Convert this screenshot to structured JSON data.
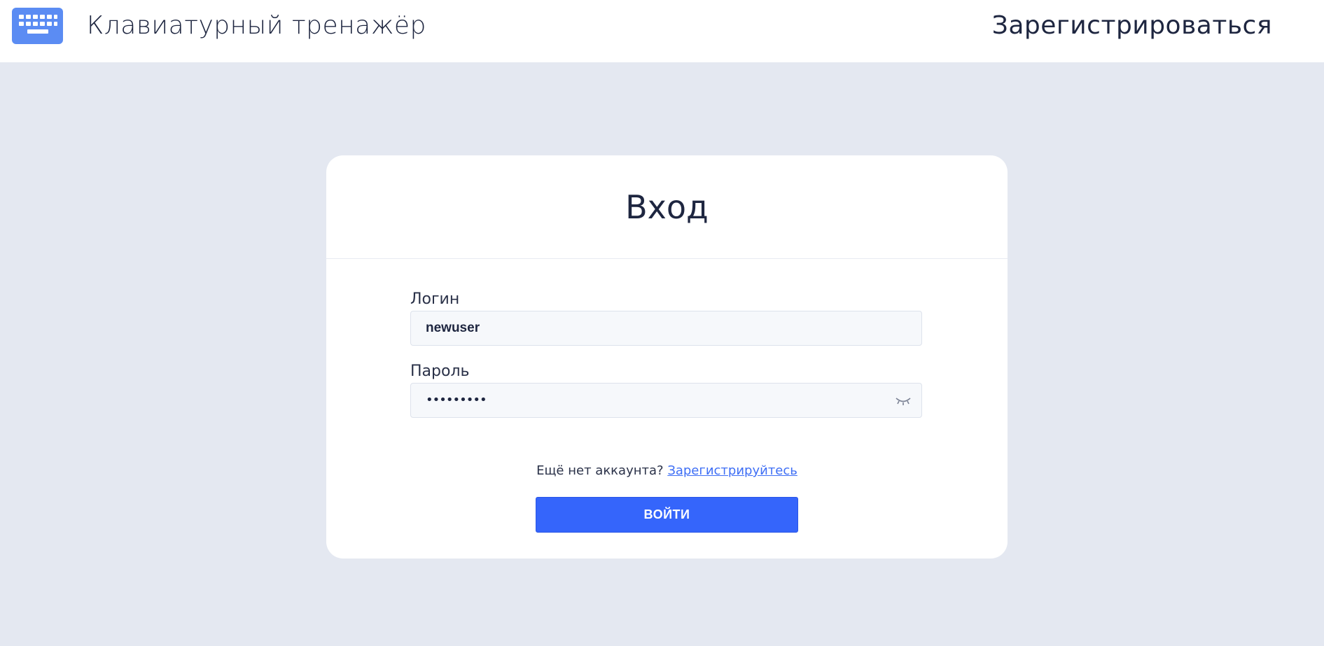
{
  "header": {
    "app_title": "Клавиатурный тренажёр",
    "register_link": "Зарегистрироваться",
    "logo_icon": "keyboard-icon"
  },
  "login_form": {
    "title": "Вход",
    "login_label": "Логин",
    "login_value": "newuser",
    "password_label": "Пароль",
    "password_value": "•••••••••",
    "password_toggle_icon": "eye-closed-icon",
    "no_account_text": "Ещё нет аккаунта?",
    "register_link": "Зарегистрируйтесь",
    "submit_label": "ВОЙТИ"
  },
  "colors": {
    "background": "#e4e8f1",
    "accent": "#3565fb",
    "logo": "#5b8cf3",
    "text": "#1e2640",
    "link": "#3f6ff5"
  }
}
